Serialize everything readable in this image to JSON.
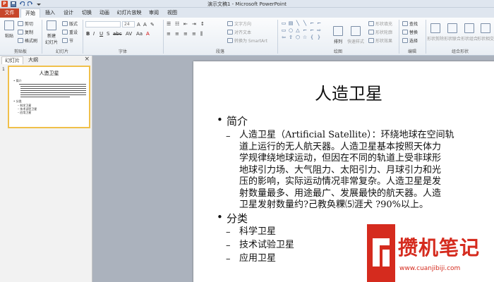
{
  "titlebar": {
    "title": "演示文稿1 - Microsoft PowerPoint",
    "app_icon": "P"
  },
  "tabs": [
    "文件",
    "开始",
    "插入",
    "设计",
    "切换",
    "动画",
    "幻灯片放映",
    "审阅",
    "视图"
  ],
  "ribbon": {
    "clipboard": {
      "paste": "粘贴",
      "cut": "剪切",
      "copy": "复制",
      "format_painter": "格式刷",
      "label": "剪贴板"
    },
    "slides": {
      "new_slide": "新建\n幻灯片",
      "layout": "版式",
      "reset": "重设",
      "section": "节",
      "label": "幻灯片"
    },
    "font": {
      "font_name": "",
      "font_size": "24",
      "label": "字体"
    },
    "paragraph": {
      "text_direction": "文字方向",
      "align_text": "对齐文本",
      "smartart": "转换为 SmartArt",
      "label": "段落"
    },
    "drawing": {
      "arrange": "排列",
      "quick_styles": "快速样式",
      "fill": "形状填充",
      "outline": "形状轮廓",
      "effects": "形状效果",
      "label": "绘图"
    },
    "editing": {
      "find": "查找",
      "replace": "替换",
      "select": "选择",
      "label": "编辑"
    },
    "combine": {
      "union": "形状剪除",
      "combine": "形状联合",
      "intersect": "形状组合",
      "subtract": "形状相交",
      "label": "组合形状"
    }
  },
  "panel": {
    "tab_slides": "幻灯片",
    "tab_outline": "大纲",
    "close": "×",
    "slide_number": "1"
  },
  "thumbnail": {
    "title": "人造卫星",
    "lines": [
      "• 简介",
      "– 人造卫星（Artificial Satellite）：环绕地球",
      "• 分类",
      "– 科学卫星",
      "– 技术试验卫星",
      "– 应用卫星"
    ]
  },
  "slide": {
    "title": "人造卫星",
    "section1": "简介",
    "para_lines": [
      "人造卫星（Artificial Satellite）：环绕地球在空间轨",
      "道上运行的无人航天器。人造卫星基本按照天体力",
      "学规律绕地球运动，但因在不同的轨道上受非球形",
      "地球引力场、大气阻力、太阳引力、月球引力和光",
      "压的影响，实际运动情况非常复杂。人造卫星是发",
      "射数量最多、用途最广、发展最快的航天器。人造",
      "卫星发射数量约?己教奂粿⑸涯犬    ?90%以上。"
    ],
    "section2": "分类",
    "items": [
      "科学卫星",
      "技术试验卫星",
      "应用卫星"
    ]
  },
  "watermark": {
    "text": "攒机笔记",
    "url": "www.cuanjibiji.com"
  },
  "colors": {
    "file_tab": "#c7462b",
    "accent": "#f0c04a",
    "watermark": "#d52b1e"
  }
}
